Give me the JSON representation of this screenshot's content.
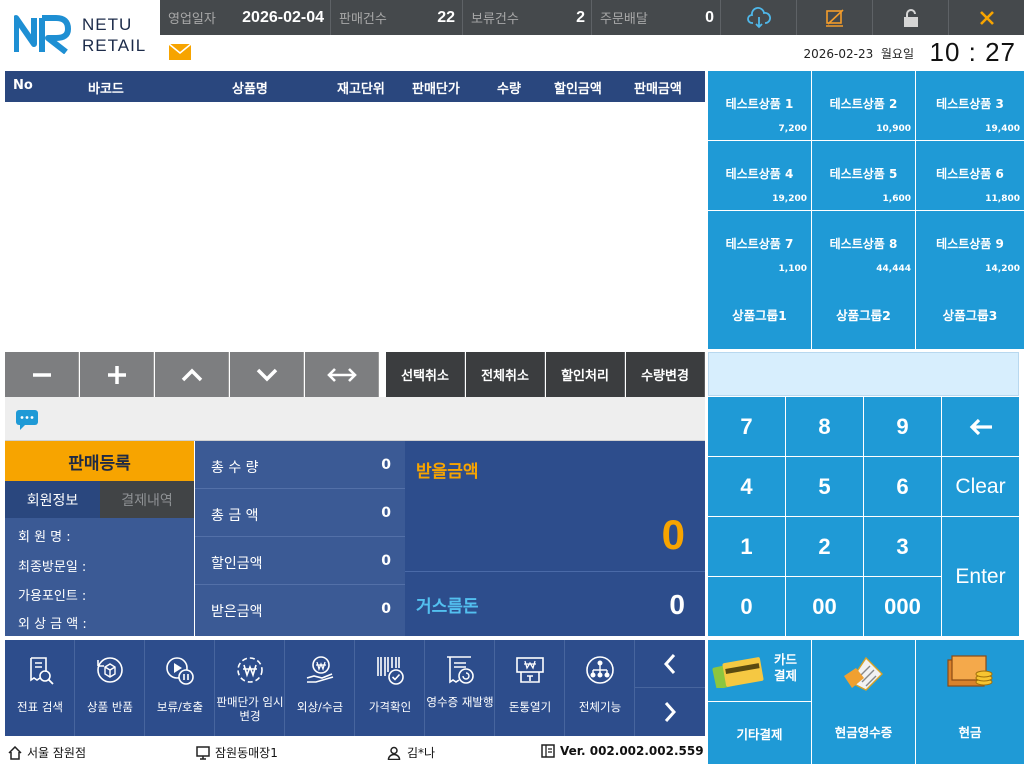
{
  "brand": {
    "line1": "NETU",
    "line2": "RETAIL"
  },
  "stats": [
    {
      "label": "영업일자",
      "value": "2026-02-04"
    },
    {
      "label": "판매건수",
      "value": "22"
    },
    {
      "label": "보류건수",
      "value": "2"
    },
    {
      "label": "주문배달",
      "value": "0"
    }
  ],
  "top_icons": [
    "cloud-sync-icon",
    "screen-off-icon",
    "lock-icon",
    "close-icon"
  ],
  "datetime": {
    "date": "2026-02-23  월요일",
    "time": "10 : 27"
  },
  "table": {
    "columns": [
      "No",
      "바코드",
      "상품명",
      "재고단위",
      "판매단가",
      "수량",
      "할인금액",
      "판매금액"
    ]
  },
  "toolbar": {
    "tools": [
      "minus-icon",
      "plus-icon",
      "chevron-up-icon",
      "chevron-down-icon",
      "swap-horizontal-icon"
    ],
    "actions": [
      "선택취소",
      "전체취소",
      "할인처리",
      "수량변경"
    ]
  },
  "sale": {
    "register": "판매등록",
    "tab_member": "회원정보",
    "tab_payment": "결제내역"
  },
  "member": {
    "name_label": "회 원 명 :",
    "visit_label": "최종방문일 :",
    "points_label": "가용포인트 :",
    "credit_label": "외 상 금 액 :"
  },
  "totals": [
    {
      "label": "총 수 량",
      "value": "0"
    },
    {
      "label": "총 금 액",
      "value": "0"
    },
    {
      "label": "할인금액",
      "value": "0"
    },
    {
      "label": "받은금액",
      "value": "0"
    }
  ],
  "receive": {
    "label": "받을금액",
    "value": "0",
    "change_label": "거스름돈",
    "change_value": "0"
  },
  "functions": [
    {
      "label": "전표 검색",
      "icon": "receipt-search-icon"
    },
    {
      "label": "상품 반품",
      "icon": "box-return-icon"
    },
    {
      "label": "보류/호출",
      "icon": "play-pause-icon"
    },
    {
      "label": "판매단가 임시변경",
      "icon": "won-refresh-icon"
    },
    {
      "label": "외상/수금",
      "icon": "won-hand-icon"
    },
    {
      "label": "가격확인",
      "icon": "barcode-check-icon"
    },
    {
      "label": "영수증 재발행",
      "icon": "receipt-reprint-icon"
    },
    {
      "label": "돈통열기",
      "icon": "cash-drawer-icon"
    },
    {
      "label": "전체기능",
      "icon": "all-functions-icon"
    }
  ],
  "products": [
    {
      "name": "테스트상품 1",
      "price": "7,200"
    },
    {
      "name": "테스트상품 2",
      "price": "10,900"
    },
    {
      "name": "테스트상품 3",
      "price": "19,400"
    },
    {
      "name": "테스트상품 4",
      "price": "19,200"
    },
    {
      "name": "테스트상품 5",
      "price": "1,600"
    },
    {
      "name": "테스트상품 6",
      "price": "11,800"
    },
    {
      "name": "테스트상품 7",
      "price": "1,100"
    },
    {
      "name": "테스트상품 8",
      "price": "44,444"
    },
    {
      "name": "테스트상품 9",
      "price": "14,200"
    }
  ],
  "groups": [
    "상품그룹1",
    "상품그룹2",
    "상품그룹3"
  ],
  "keypad": {
    "keys": [
      "7",
      "8",
      "9",
      "4",
      "5",
      "6",
      "1",
      "2",
      "3",
      "0",
      "00",
      "000"
    ],
    "clear": "Clear",
    "enter": "Enter"
  },
  "payments": {
    "card": "카드\n결제",
    "other": "기타결제",
    "cash_receipt": "현금영수증",
    "cash": "현금"
  },
  "status": {
    "store": "서울 잠원점",
    "terminal": "잠원동매장1",
    "user": "김*나",
    "version": "Ver. 002.002.002.559"
  },
  "colors": {
    "navy": "#2a477e",
    "panel": "#3b5a95",
    "accent": "#f7a400",
    "tile": "#1f9ad6",
    "header": "#45494c"
  }
}
